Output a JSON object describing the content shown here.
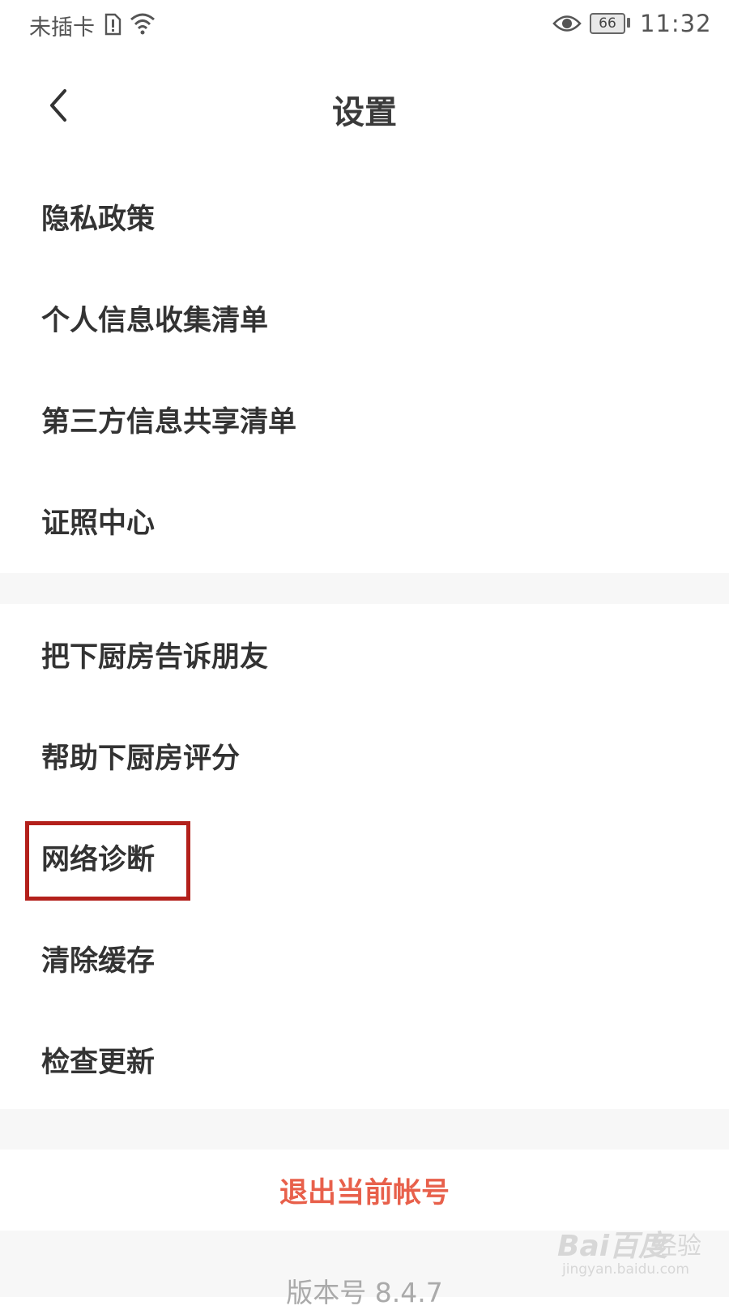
{
  "status_bar": {
    "carrier": "未插卡",
    "battery": "66",
    "time": "11:32",
    "icons": [
      "sim-alert-icon",
      "wifi-icon",
      "eye-icon",
      "battery-icon"
    ]
  },
  "header": {
    "title": "设置",
    "back_icon": "chevron-left-icon"
  },
  "sections": [
    {
      "items": [
        {
          "label": "隐私政策"
        },
        {
          "label": "个人信息收集清单"
        },
        {
          "label": "第三方信息共享清单"
        },
        {
          "label": "证照中心"
        }
      ]
    },
    {
      "items": [
        {
          "label": "把下厨房告诉朋友"
        },
        {
          "label": "帮助下厨房评分"
        },
        {
          "label": "网络诊断"
        },
        {
          "label": "清除缓存"
        },
        {
          "label": "检查更新"
        }
      ]
    }
  ],
  "logout": {
    "label": "退出当前帐号",
    "color": "#e8604b"
  },
  "version": "版本号 8.4.7",
  "highlight": {
    "target": "网络诊断",
    "color": "#b3201b"
  },
  "watermark": {
    "logo": "Bai百度",
    "name": "经验",
    "url": "jingyan.baidu.com"
  }
}
